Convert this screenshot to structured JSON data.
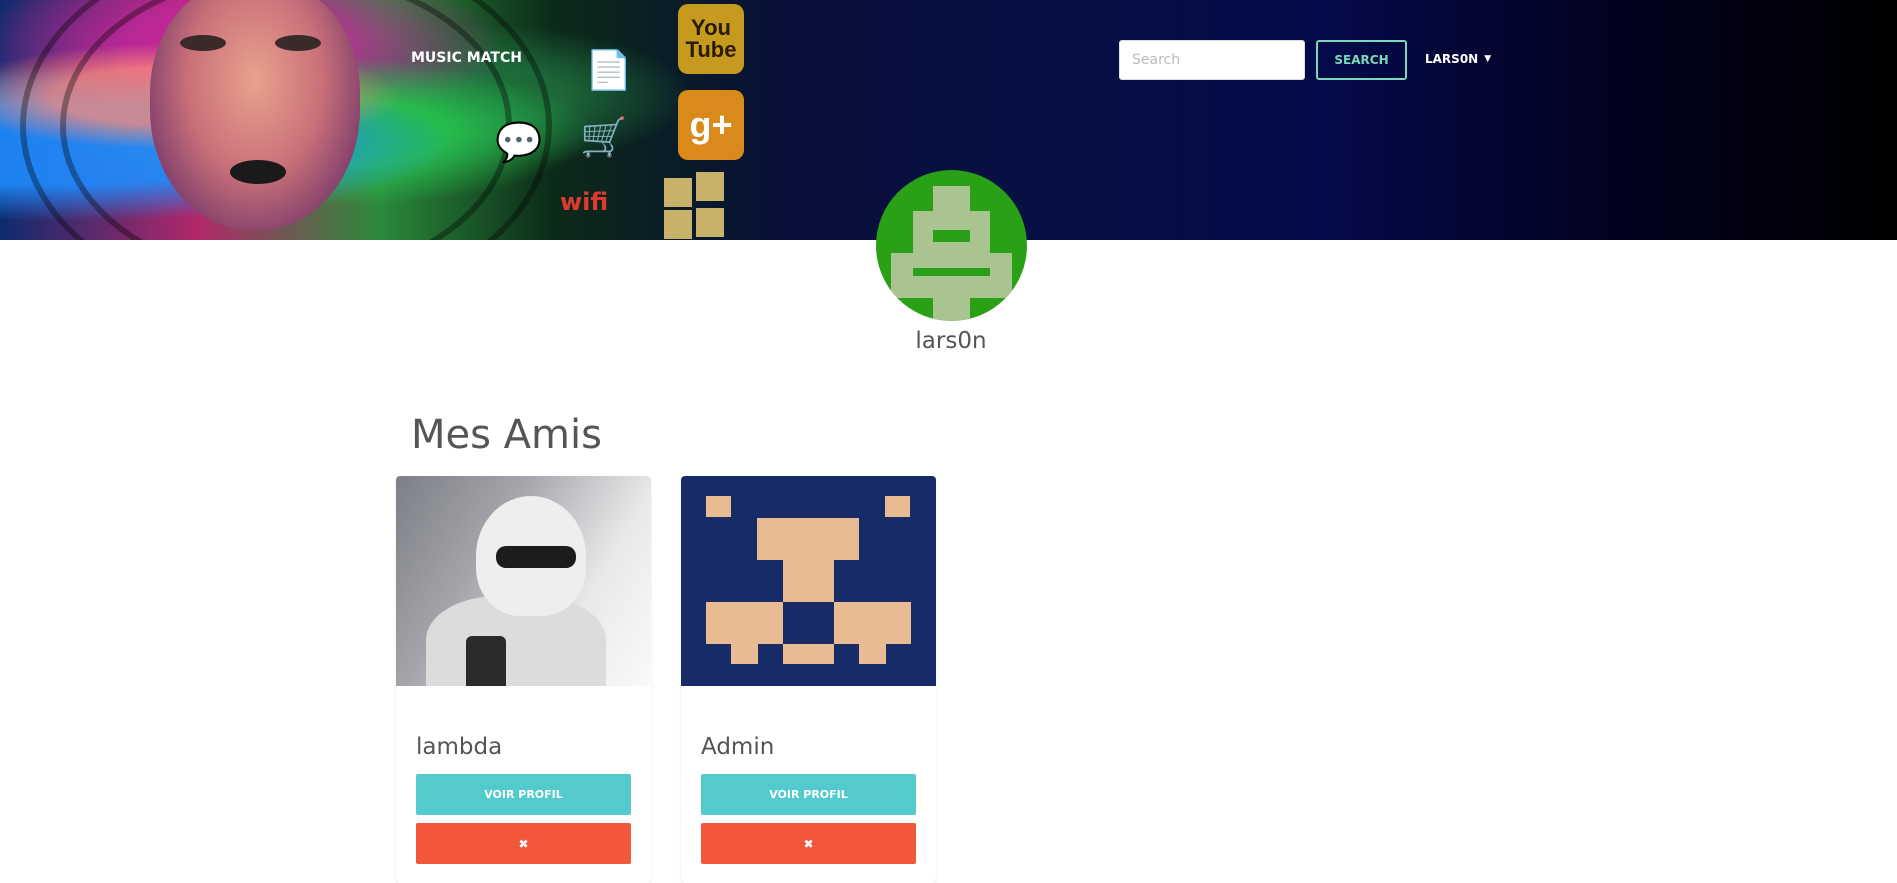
{
  "header": {
    "brand": "MUSIC MATCH",
    "search_placeholder": "Search",
    "search_button": "SEARCH",
    "user_menu_label": "LARS0N",
    "banner_tiles": {
      "youtube": "You\nTube",
      "google_plus": "g+"
    }
  },
  "profile": {
    "username": "lars0n",
    "avatar_color": "#2aa016"
  },
  "friends_section": {
    "title": "Mes Amis",
    "friends": [
      {
        "name": "lambda",
        "view_label": "VOIR PROFIL",
        "remove_label": "✖"
      },
      {
        "name": "Admin",
        "view_label": "VOIR PROFIL",
        "remove_label": "✖"
      }
    ]
  },
  "colors": {
    "accent_teal": "#53cbcc",
    "danger": "#f2573b",
    "search_outline": "#7ad9b9",
    "header_bg": "#071043"
  }
}
